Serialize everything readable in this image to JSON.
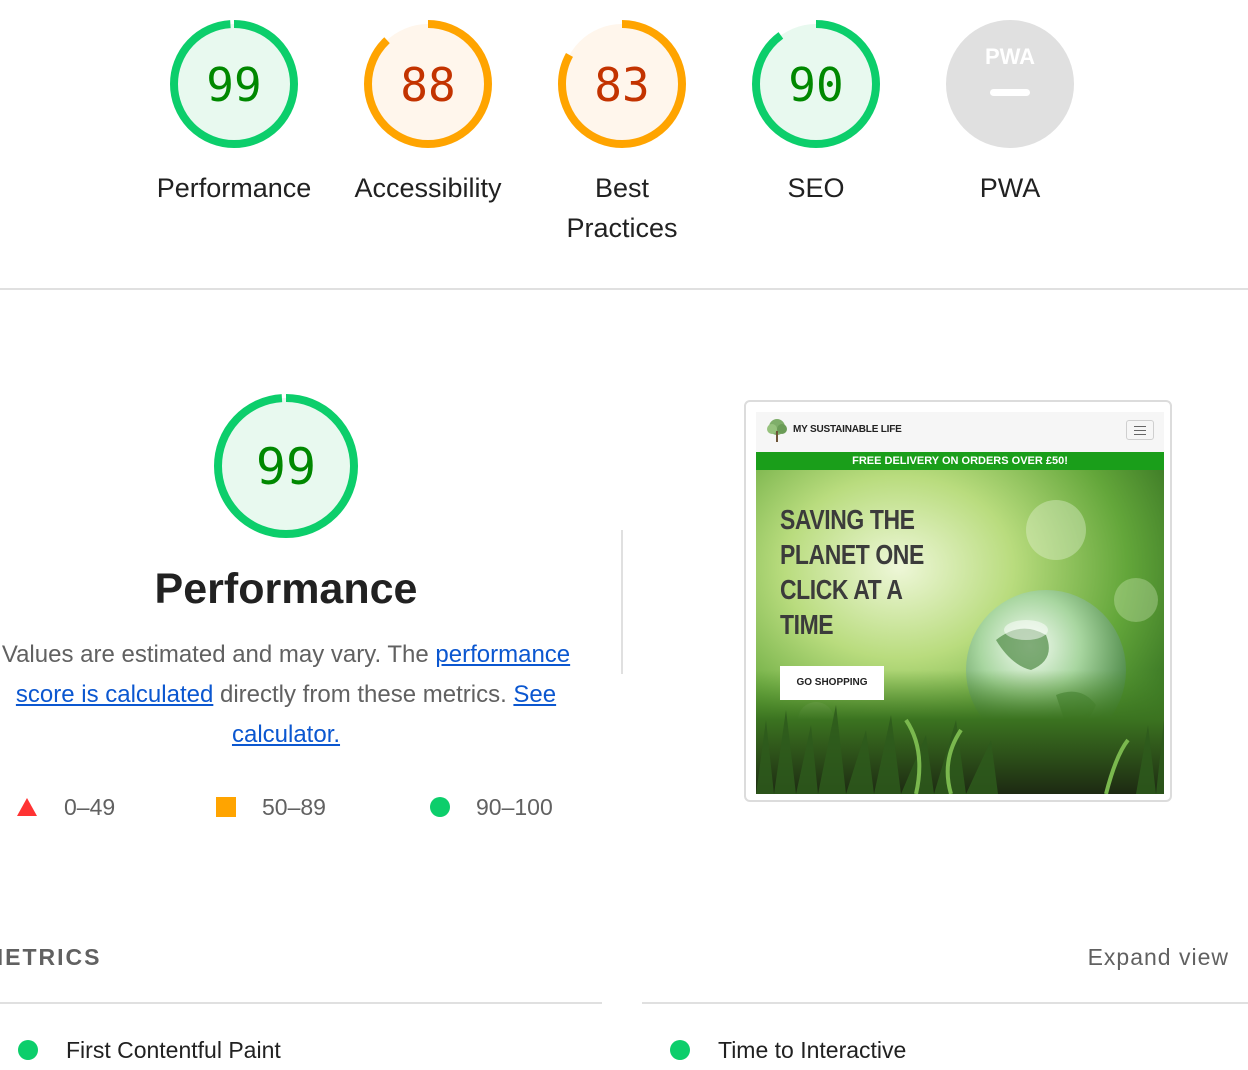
{
  "summary": {
    "gauges": [
      {
        "id": "performance",
        "score": "99",
        "label": "Performance",
        "rating": "pass",
        "fraction": 0.99
      },
      {
        "id": "accessibility",
        "score": "88",
        "label": "Accessibility",
        "rating": "average",
        "fraction": 0.88
      },
      {
        "id": "best-practices",
        "score": "83",
        "label_line1": "Best",
        "label_line2": "Practices",
        "rating": "average",
        "fraction": 0.83
      },
      {
        "id": "seo",
        "score": "90",
        "label": "SEO",
        "rating": "pass",
        "fraction": 0.9
      },
      {
        "id": "pwa",
        "badge": "PWA",
        "label": "PWA",
        "rating": "na"
      }
    ]
  },
  "colors": {
    "pass_stroke": "#0cce6b",
    "pass_fill": "#e8f9ef",
    "pass_text": "#008800",
    "average_stroke": "#ffa400",
    "average_fill": "#fff6ec",
    "average_text": "#c33300",
    "fail": "#ff3333",
    "na_fill": "#e0e0e0",
    "na_text": "#ffffff",
    "link": "#0b57d0",
    "promo_bar": "#1a9e1a"
  },
  "performance": {
    "score": "99",
    "fraction": 0.99,
    "title": "Performance",
    "description": {
      "prefix": "Values are estimated and may vary. The ",
      "link1": "performance score is calculated",
      "middle": " directly from these metrics. ",
      "link2": "See calculator."
    },
    "legend": [
      {
        "shape": "triangle-icon",
        "range": "0–49"
      },
      {
        "shape": "square-icon",
        "range": "50–89"
      },
      {
        "shape": "circle-icon",
        "range": "90–100"
      }
    ]
  },
  "screenshot": {
    "site_name": "MY SUSTAINABLE LIFE",
    "promo": "FREE DELIVERY ON ORDERS OVER £50!",
    "hero_title": "SAVING THE PLANET ONE CLICK AT A TIME",
    "cta": "GO SHOPPING"
  },
  "metrics": {
    "title": "METRICS",
    "expand": "Expand view",
    "items": [
      {
        "name": "First Contentful Paint",
        "rating": "pass"
      },
      {
        "name": "Time to Interactive",
        "rating": "pass"
      }
    ]
  }
}
